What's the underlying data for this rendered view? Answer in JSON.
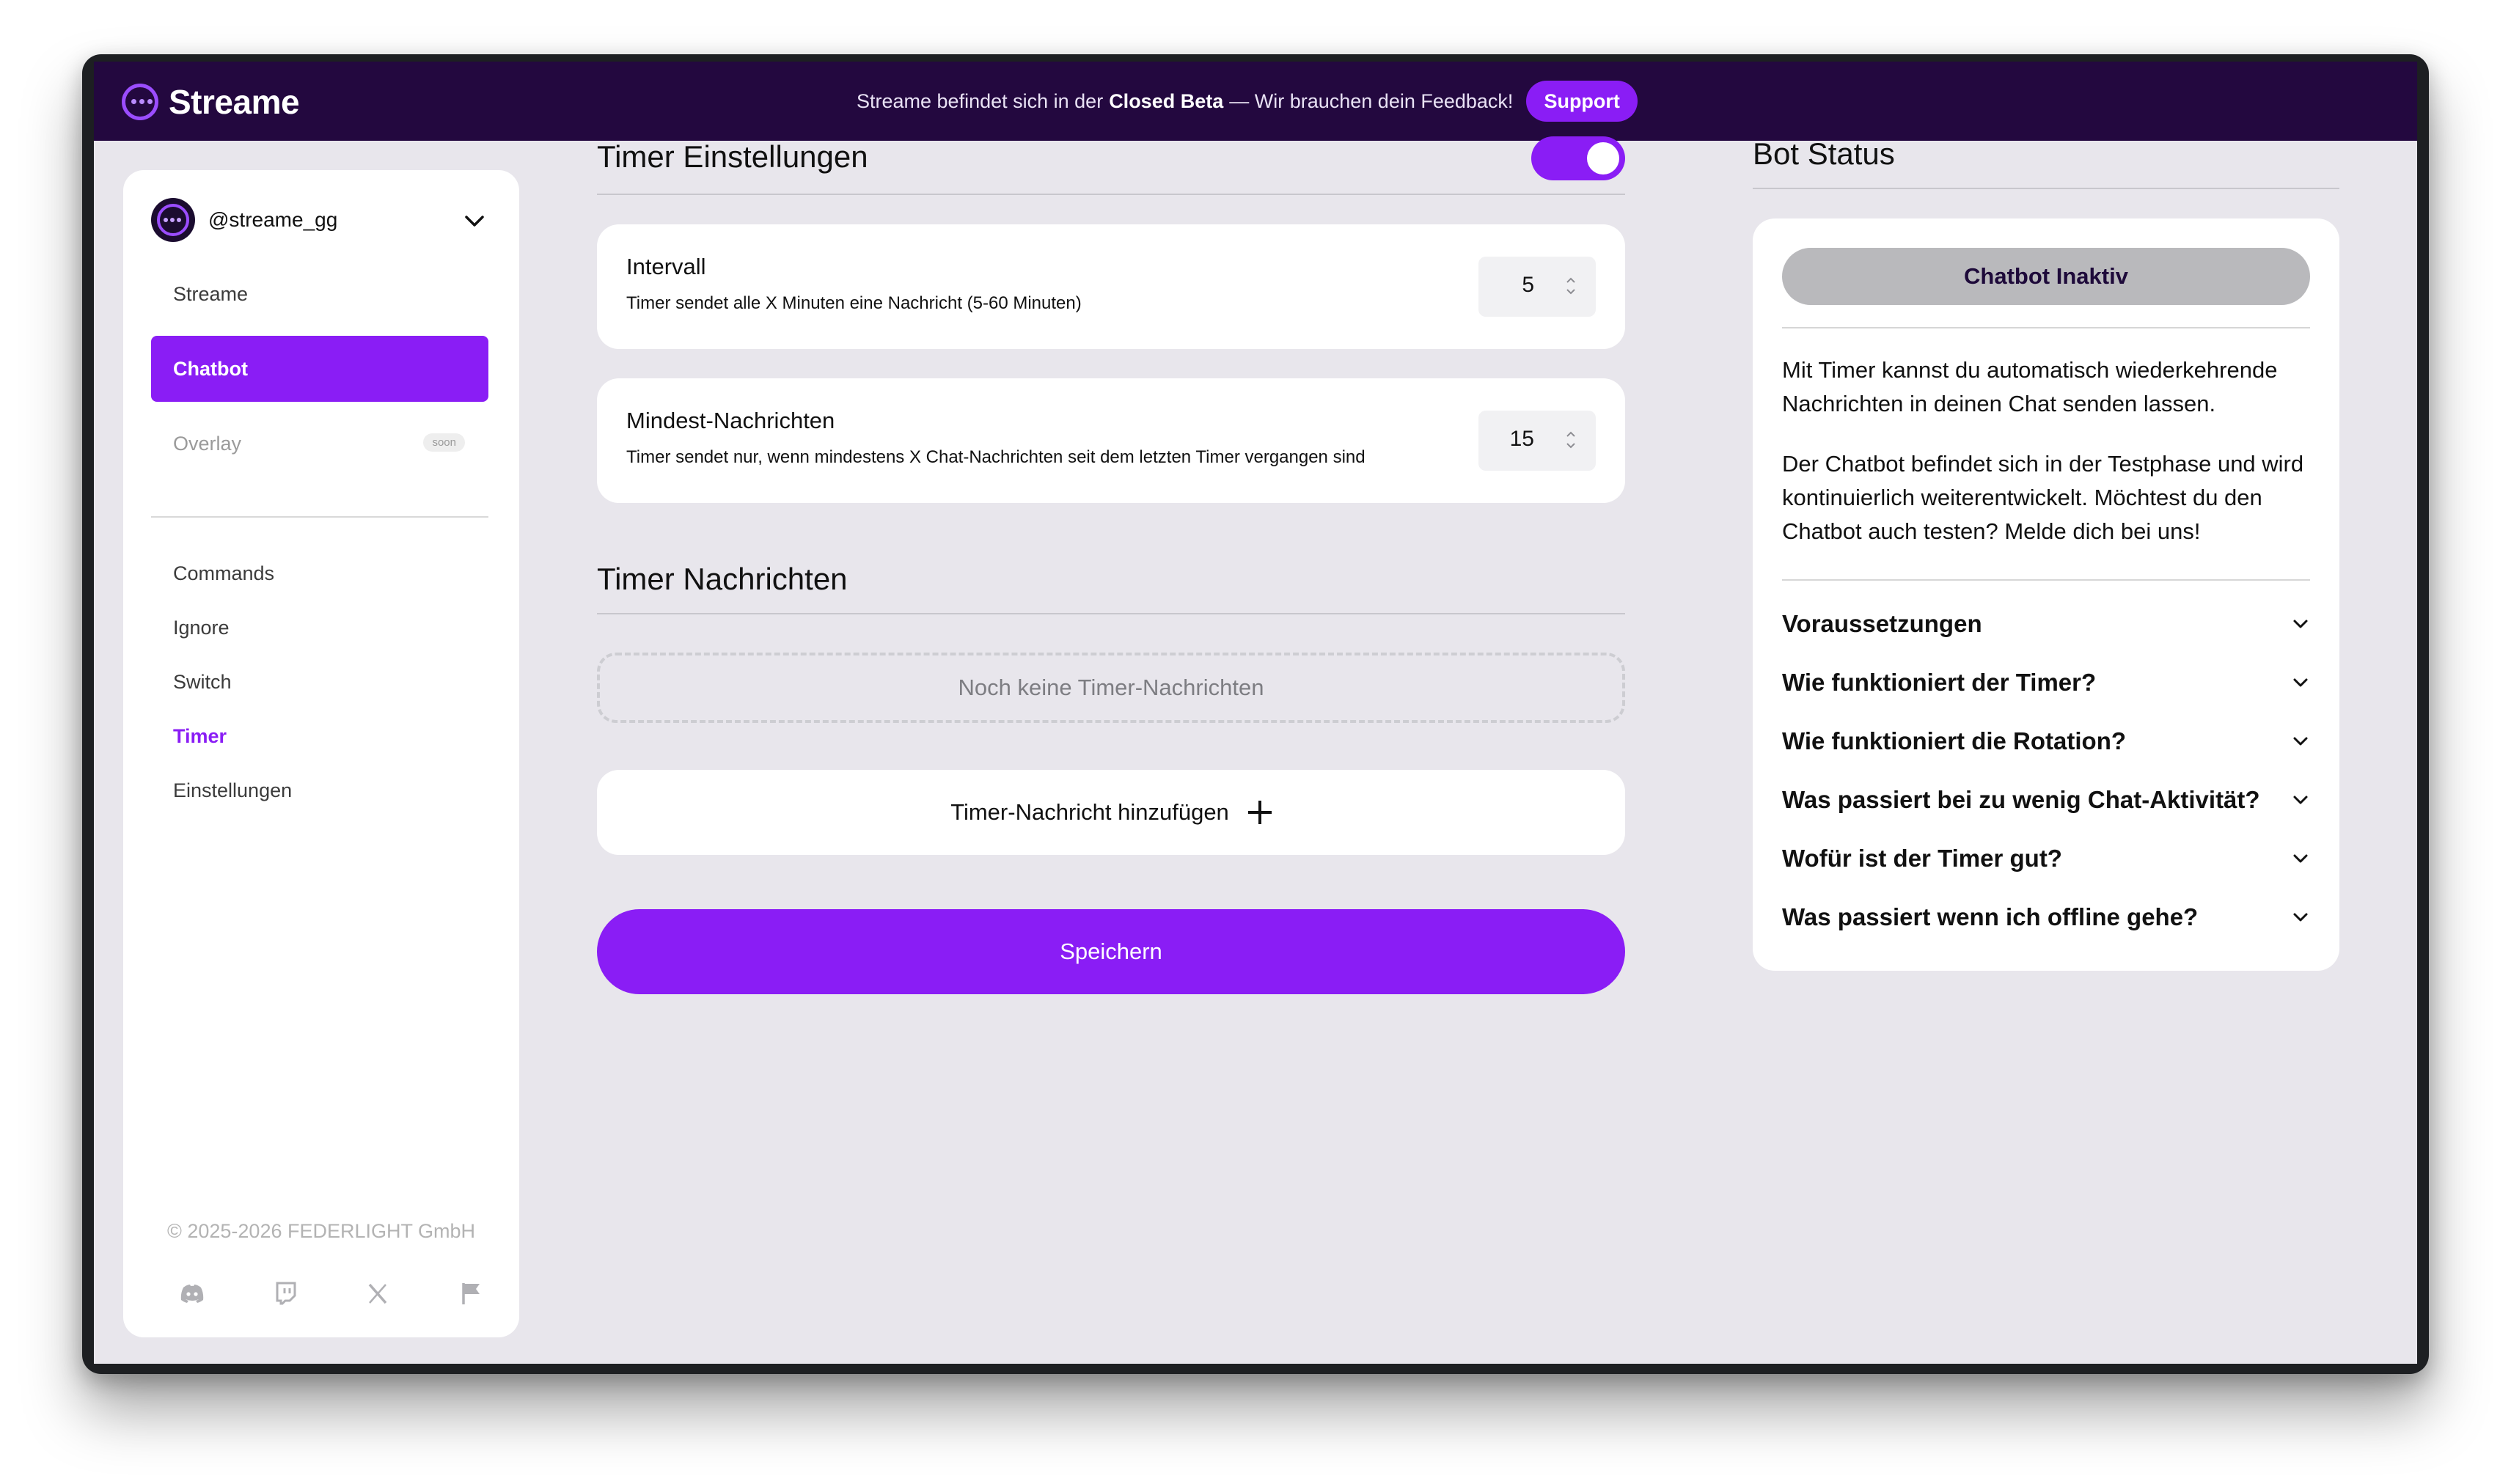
{
  "header": {
    "brand": "Streame",
    "beta_prefix": "Streame befindet sich in der",
    "beta_bold": "Closed Beta",
    "beta_suffix": "— Wir brauchen dein Feedback!",
    "support_label": "Support"
  },
  "sidebar": {
    "account": "@streame_gg",
    "nav": [
      {
        "label": "Streame"
      },
      {
        "label": "Chatbot"
      },
      {
        "label": "Overlay",
        "badge": "soon"
      }
    ],
    "sub_nav": [
      {
        "label": "Commands"
      },
      {
        "label": "Ignore"
      },
      {
        "label": "Switch"
      },
      {
        "label": "Timer"
      },
      {
        "label": "Einstellungen"
      }
    ],
    "copyright": "© 2025-2026 FEDERLIGHT GmbH",
    "social_icons": [
      "discord-icon",
      "twitch-icon",
      "x-icon",
      "flag-icon"
    ]
  },
  "timer_settings": {
    "title": "Timer Einstellungen",
    "enabled": true,
    "interval": {
      "title": "Intervall",
      "description": "Timer sendet alle X Minuten eine Nachricht (5-60 Minuten)",
      "value": "5"
    },
    "min_messages": {
      "title": "Mindest-Nachrichten",
      "description": "Timer sendet nur, wenn mindestens X Chat-Nachrichten seit dem letzten Timer vergangen sind",
      "value": "15"
    }
  },
  "timer_messages": {
    "title": "Timer Nachrichten",
    "empty_text": "Noch keine Timer-Nachrichten",
    "add_label": "Timer-Nachricht hinzufügen"
  },
  "save_label": "Speichern",
  "bot_status": {
    "title": "Bot Status",
    "status_label": "Chatbot Inaktiv",
    "paragraph1": "Mit Timer kannst du automatisch wiederkehrende Nachrichten in deinen Chat senden lassen.",
    "paragraph2": "Der Chatbot befindet sich in der Testphase und wird kontinuierlich weiterentwickelt. Möchtest du den Chatbot auch testen? Melde dich bei uns!",
    "faq": [
      "Voraussetzungen",
      "Wie funktioniert der Timer?",
      "Wie funktioniert die Rotation?",
      "Was passiert bei zu wenig Chat-Aktivität?",
      "Wofür ist der Timer gut?",
      "Was passiert wenn ich offline gehe?"
    ]
  },
  "colors": {
    "accent": "#8a1df5",
    "header_bg": "#23083f",
    "page_bg": "#e8e6ec",
    "status_inactive": "#b9b9bc"
  }
}
